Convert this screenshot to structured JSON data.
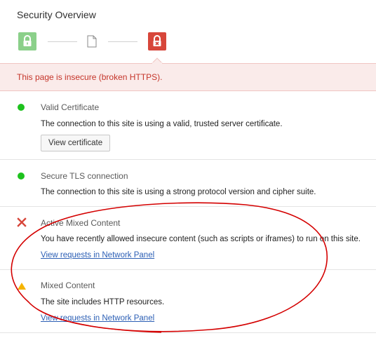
{
  "panel": {
    "title": "Security Overview"
  },
  "chain": {
    "left_icon": "lock-closed-icon",
    "middle_icon": "document-icon",
    "right_icon": "lock-broken-icon"
  },
  "banner": {
    "text": "This page is insecure (broken HTTPS).",
    "color": "#c5352a"
  },
  "sections": [
    {
      "status": "secure",
      "status_icon": "green-dot-icon",
      "title": "Valid Certificate",
      "description": "The connection to this site is using a valid, trusted server certificate.",
      "button": "View certificate"
    },
    {
      "status": "secure",
      "status_icon": "green-dot-icon",
      "title": "Secure TLS connection",
      "description": "The connection to this site is using a strong protocol version and cipher suite."
    },
    {
      "status": "insecure",
      "status_icon": "red-x-icon",
      "title": "Active Mixed Content",
      "description": "You have recently allowed insecure content (such as scripts or iframes) to run on this site.",
      "link": "View requests in Network Panel"
    },
    {
      "status": "warning",
      "status_icon": "warning-triangle-icon",
      "title": "Mixed Content",
      "description": "The site includes HTTP resources.",
      "link": "View requests in Network Panel"
    }
  ],
  "colors": {
    "secure": "#1ec21e",
    "insecure": "#d7463a",
    "warning": "#f5b400",
    "link": "#2c5fb5",
    "annotation": "#d40000"
  }
}
